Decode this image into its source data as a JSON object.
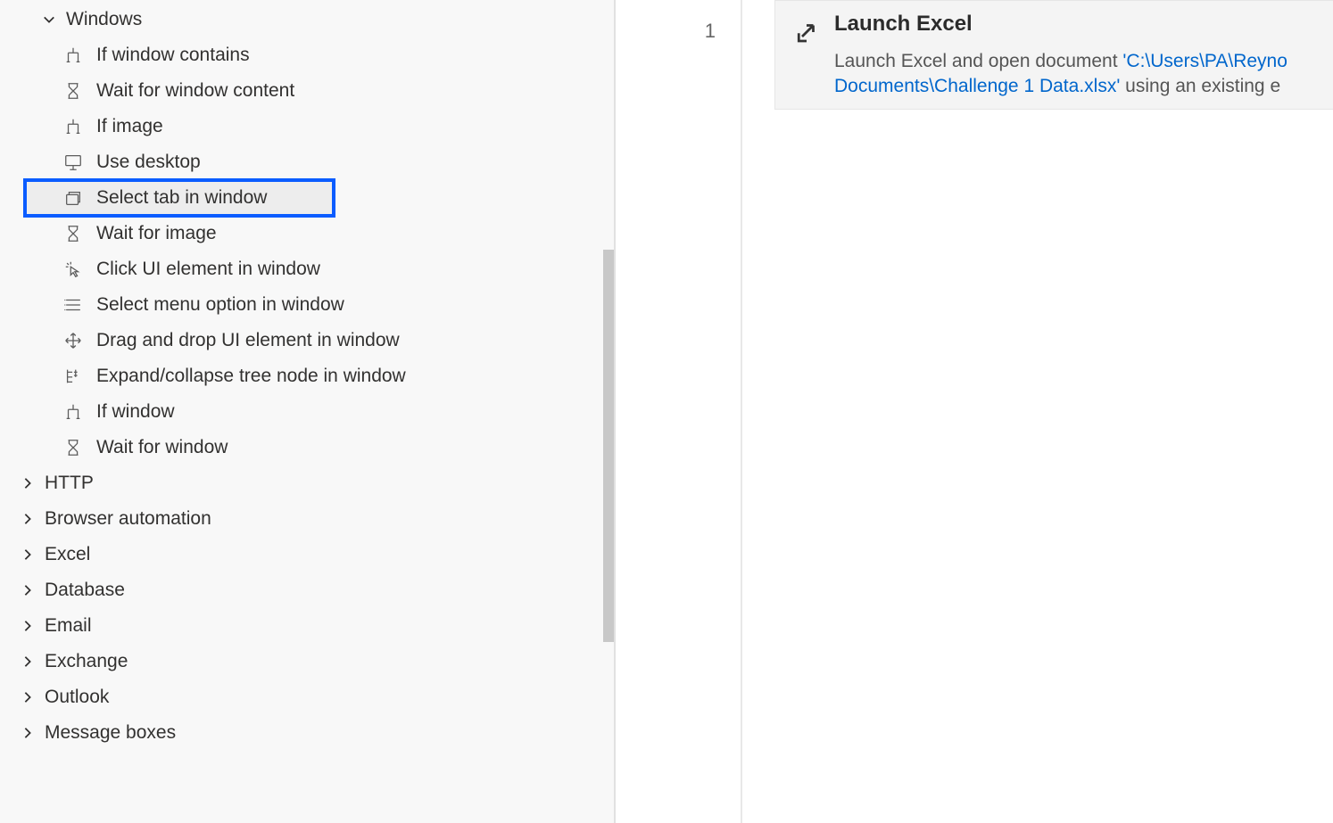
{
  "actions_tree": {
    "expanded_group": {
      "label": "Windows",
      "items": [
        {
          "id": "if-window-contains",
          "label": "If window contains",
          "icon": "flow-if"
        },
        {
          "id": "wait-window-content",
          "label": "Wait for window content",
          "icon": "hourglass"
        },
        {
          "id": "if-image",
          "label": "If image",
          "icon": "flow-if"
        },
        {
          "id": "use-desktop",
          "label": "Use desktop",
          "icon": "monitor"
        },
        {
          "id": "select-tab",
          "label": "Select tab in window",
          "icon": "tabs",
          "highlighted": true
        },
        {
          "id": "wait-image",
          "label": "Wait for image",
          "icon": "hourglass"
        },
        {
          "id": "click-ui",
          "label": "Click UI element in window",
          "icon": "click"
        },
        {
          "id": "select-menu",
          "label": "Select menu option in window",
          "icon": "menu-lines"
        },
        {
          "id": "drag-drop",
          "label": "Drag and drop UI element in window",
          "icon": "drag"
        },
        {
          "id": "expand-tree",
          "label": "Expand/collapse tree node in window",
          "icon": "tree"
        },
        {
          "id": "if-window",
          "label": "If window",
          "icon": "flow-if"
        },
        {
          "id": "wait-window",
          "label": "Wait for window",
          "icon": "hourglass"
        }
      ]
    },
    "collapsed_groups": [
      "HTTP",
      "Browser automation",
      "Excel",
      "Database",
      "Email",
      "Exchange",
      "Outlook",
      "Message boxes"
    ]
  },
  "editor": {
    "line_number": "1",
    "step": {
      "title": "Launch Excel",
      "desc_prefix": "Launch Excel and open document ",
      "path": "'C:\\Users\\PA\\Reyno Documents\\Challenge 1 Data.xlsx'",
      "desc_suffix": " using an existing e"
    }
  }
}
